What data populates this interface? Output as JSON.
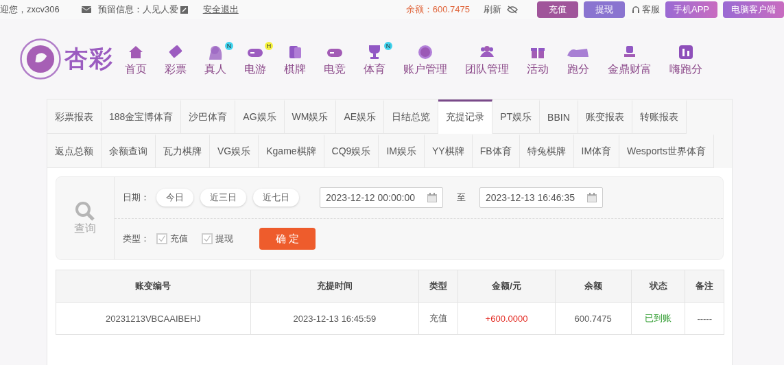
{
  "top_bar": {
    "greeting": "迎您，zxcv306",
    "reserved_info": "预留信息：人见人爱",
    "logout": "安全退出",
    "balance": "余额：600.7475",
    "refresh": "刷新",
    "deposit": "充值",
    "withdraw": "提现",
    "service": "客服",
    "mobile_app": "手机APP",
    "desktop_client": "电脑客户端"
  },
  "logo": {
    "text": "杏彩"
  },
  "nav": [
    {
      "label": "首页"
    },
    {
      "label": "彩票"
    },
    {
      "label": "真人",
      "badge": "N"
    },
    {
      "label": "电游",
      "badge": "H"
    },
    {
      "label": "棋牌"
    },
    {
      "label": "电竞"
    },
    {
      "label": "体育",
      "badge": "N"
    },
    {
      "label": "账户管理"
    },
    {
      "label": "团队管理"
    },
    {
      "label": "活动"
    },
    {
      "label": "跑分"
    },
    {
      "label": "金鼎财富"
    },
    {
      "label": "嗨跑分"
    }
  ],
  "tabs": [
    {
      "label": "彩票报表",
      "selected": false
    },
    {
      "label": "188金宝博体育",
      "selected": false
    },
    {
      "label": "沙巴体育",
      "selected": false
    },
    {
      "label": "AG娱乐",
      "selected": false
    },
    {
      "label": "WM娱乐",
      "selected": false
    },
    {
      "label": "AE娱乐",
      "selected": false
    },
    {
      "label": "日结总览",
      "selected": false
    },
    {
      "label": "充提记录",
      "selected": true
    },
    {
      "label": "PT娱乐",
      "selected": false
    },
    {
      "label": "BBIN",
      "selected": false
    },
    {
      "label": "账变报表",
      "selected": false
    },
    {
      "label": "转账报表",
      "selected": false
    },
    {
      "label": "返点总额",
      "selected": false
    },
    {
      "label": "余额查询",
      "selected": false
    },
    {
      "label": "瓦力棋牌",
      "selected": false
    },
    {
      "label": "VG娱乐",
      "selected": false
    },
    {
      "label": "Kgame棋牌",
      "selected": false
    },
    {
      "label": "CQ9娱乐",
      "selected": false
    },
    {
      "label": "IM娱乐",
      "selected": false
    },
    {
      "label": "YY棋牌",
      "selected": false
    },
    {
      "label": "FB体育",
      "selected": false
    },
    {
      "label": "特兔棋牌",
      "selected": false
    },
    {
      "label": "IM体育",
      "selected": false
    },
    {
      "label": "Wesports世界体育",
      "selected": false
    }
  ],
  "filter": {
    "query_label": "查询",
    "date_label": "日期：",
    "quick_ranges": [
      "今日",
      "近三日",
      "近七日"
    ],
    "start": "2023-12-12 00:00:00",
    "to": "至",
    "end": "2023-12-13 16:46:35",
    "type_label": "类型：",
    "types": [
      {
        "label": "充值",
        "checked": true
      },
      {
        "label": "提现",
        "checked": true
      }
    ],
    "confirm": "确 定"
  },
  "table": {
    "columns": [
      "账变编号",
      "充提时间",
      "类型",
      "金额/元",
      "余额",
      "状态",
      "备注"
    ],
    "rows": [
      [
        "20231213VBCAAIBEHJ",
        "2023-12-13 16:45:59",
        "充值",
        "+600.0000",
        "600.7475",
        "已到账",
        "-----"
      ]
    ]
  }
}
